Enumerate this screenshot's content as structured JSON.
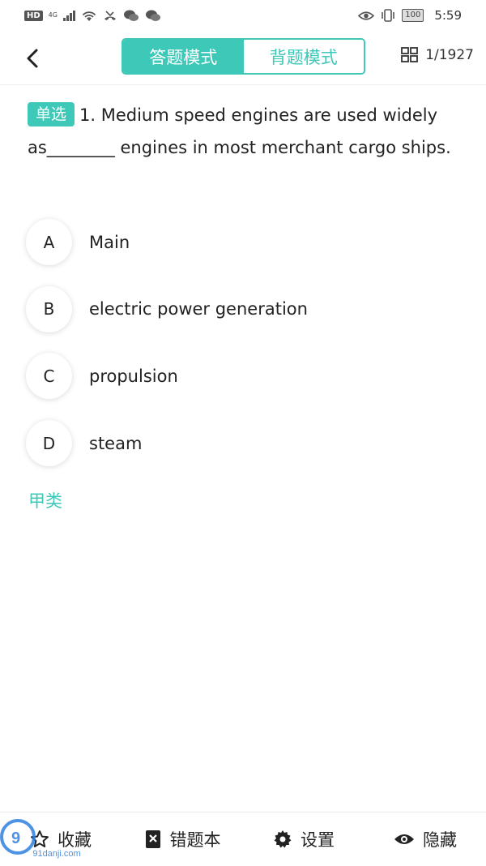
{
  "status_bar": {
    "hd": "HD",
    "network": "4G",
    "battery": "100",
    "time": "5:59"
  },
  "header": {
    "modes": [
      "答题模式",
      "背题模式"
    ],
    "active_mode_index": 0,
    "counter": "1/1927"
  },
  "question": {
    "tag": "单选",
    "text": "1. Medium speed engines are used widely as________ engines in most merchant cargo ships.",
    "options": [
      {
        "letter": "A",
        "text": "Main"
      },
      {
        "letter": "B",
        "text": "electric power generation"
      },
      {
        "letter": "C",
        "text": "propulsion"
      },
      {
        "letter": "D",
        "text": "steam"
      }
    ],
    "category": "甲类"
  },
  "bottom_bar": {
    "items": [
      {
        "label": "收藏",
        "icon": "star-icon"
      },
      {
        "label": "错题本",
        "icon": "notebook-icon"
      },
      {
        "label": "设置",
        "icon": "gear-icon"
      },
      {
        "label": "隐藏",
        "icon": "eye-icon"
      }
    ]
  },
  "colors": {
    "accent": "#3dc8b8"
  },
  "watermark": {
    "text": "91danji.com"
  }
}
